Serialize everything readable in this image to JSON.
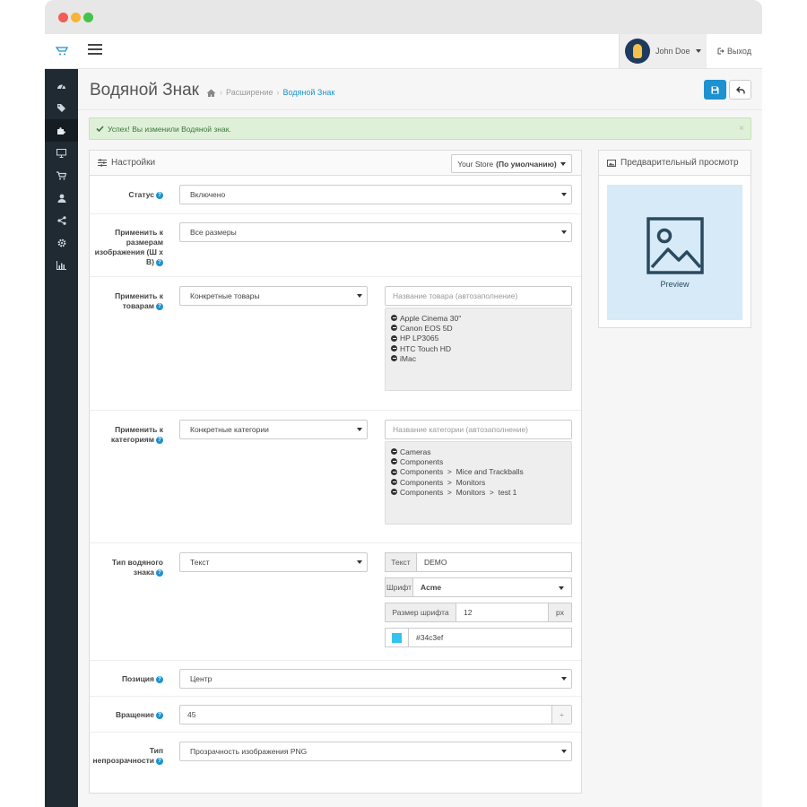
{
  "colors": {
    "accent": "#1e91cf",
    "sidebar": "#1f2a33",
    "success_bg": "#dff0d8",
    "preview_bg": "#d6eaf8",
    "swatch": "#34c3ef"
  },
  "window": {
    "controls": [
      "close",
      "minimize",
      "maximize"
    ]
  },
  "topbar": {
    "user_name": "John Doe",
    "logout_label": "Выход"
  },
  "sidebar": {
    "items": [
      {
        "icon": "dashboard-icon",
        "active": false
      },
      {
        "icon": "tags-icon",
        "active": false
      },
      {
        "icon": "puzzle-icon",
        "active": true
      },
      {
        "icon": "monitor-icon",
        "active": false
      },
      {
        "icon": "cart-icon",
        "active": false
      },
      {
        "icon": "user-icon",
        "active": false
      },
      {
        "icon": "share-icon",
        "active": false
      },
      {
        "icon": "gear-icon",
        "active": false
      },
      {
        "icon": "bar-chart-icon",
        "active": false
      }
    ]
  },
  "header": {
    "title": "Водяной Знак",
    "breadcrumb": [
      "Расширение",
      "Водяной Знак"
    ]
  },
  "alert": {
    "text": "Успех! Вы изменили Водяной знак.",
    "close": "×"
  },
  "settings": {
    "title": "Настройки",
    "store_prefix": "Your Store",
    "store_suffix": "(По умолчанию)",
    "status": {
      "label": "Статус",
      "value": "Включено"
    },
    "sizes": {
      "label": "Применить к размерам изображения (Ш х В)",
      "value": "Все размеры"
    },
    "products": {
      "label": "Применить к товарам",
      "value": "Конкретные товары",
      "placeholder": "Название товара (автозаполнение)",
      "items": [
        "Apple Cinema 30\"",
        "Canon EOS 5D",
        "HP LP3065",
        "HTC Touch HD",
        "iMac"
      ]
    },
    "categories": {
      "label": "Применить к категориям",
      "value": "Конкретные категории",
      "placeholder": "Название категории (автозаполнение)",
      "items": [
        "Cameras",
        "Components",
        "Components  >  Mice and Trackballs",
        "Components  >  Monitors",
        "Components  >  Monitors  >  test 1"
      ]
    },
    "type": {
      "label": "Тип водяного знака",
      "value": "Текст",
      "text_label": "Текст",
      "text_value": "DEMO",
      "font_label": "Шрифт",
      "font_value": "Acme",
      "size_label": "Размер шрифта",
      "size_value": "12",
      "size_unit": "px",
      "color_value": "#34c3ef"
    },
    "position": {
      "label": "Позиция",
      "value": "Центр"
    },
    "rotation": {
      "label": "Вращение",
      "value": "45",
      "spin": "÷"
    },
    "opacity": {
      "label": "Тип непрозрачности",
      "value": "Прозрачность изображения PNG"
    }
  },
  "preview": {
    "title": "Предварительный просмотр",
    "label": "Preview"
  }
}
